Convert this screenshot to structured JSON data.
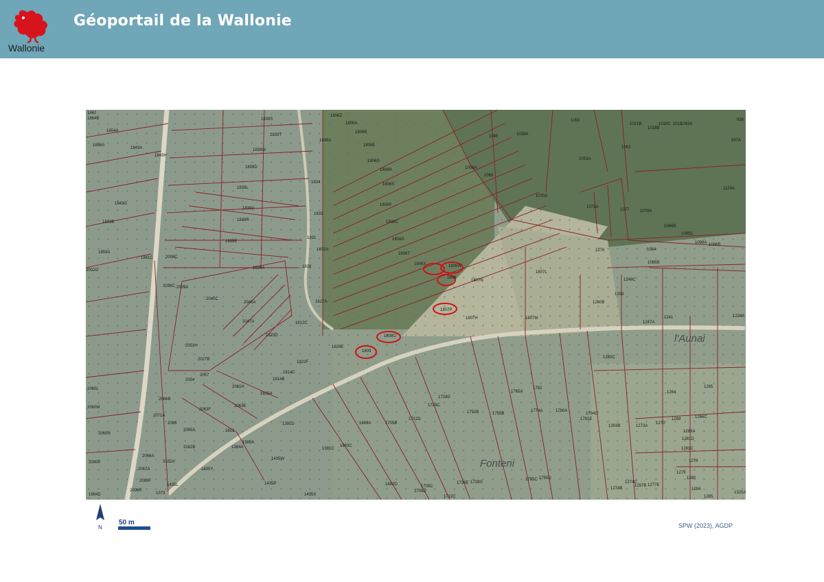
{
  "header": {
    "title": "Géoportail de la Wallonie",
    "logo_text": "Wallonie",
    "background_color": "#6fa6b8"
  },
  "map": {
    "place_labels": [
      "l'Aunai",
      "Fonteni"
    ],
    "highlighted_parcels": [
      "1809",
      "1808C",
      "1807P",
      "1806X",
      "1806",
      "1806W"
    ],
    "highlight_color": "#d0101a",
    "parcel_labels": [
      {
        "id": "p1",
        "text": "1862"
      },
      {
        "id": "p2",
        "text": "1864B"
      },
      {
        "id": "p3",
        "text": "1854A"
      },
      {
        "id": "p4",
        "text": "1856A"
      },
      {
        "id": "p5",
        "text": "1843A"
      },
      {
        "id": "p6",
        "text": "1843H"
      },
      {
        "id": "p7",
        "text": "1843G"
      },
      {
        "id": "p8",
        "text": "1843B"
      },
      {
        "id": "p9",
        "text": "1859A"
      },
      {
        "id": "p10",
        "text": "1841C"
      },
      {
        "id": "p11",
        "text": "2008C"
      },
      {
        "id": "p12",
        "text": "2038C"
      },
      {
        "id": "p13",
        "text": "2039A"
      },
      {
        "id": "p14",
        "text": "2040C"
      },
      {
        "id": "p15",
        "text": "2046A"
      },
      {
        "id": "p16",
        "text": "2047A"
      },
      {
        "id": "p17",
        "text": "2051H"
      },
      {
        "id": "p18",
        "text": "2027B"
      },
      {
        "id": "p19",
        "text": "2054"
      },
      {
        "id": "p20",
        "text": "2057"
      },
      {
        "id": "p21",
        "text": "2060L"
      },
      {
        "id": "p22",
        "text": "2060M"
      },
      {
        "id": "p23",
        "text": "2060N"
      },
      {
        "id": "p24",
        "text": "2080P"
      },
      {
        "id": "p25",
        "text": "2066A"
      },
      {
        "id": "p26",
        "text": "2067A"
      },
      {
        "id": "p27",
        "text": "2069F"
      },
      {
        "id": "p28",
        "text": "1994D"
      },
      {
        "id": "p29",
        "text": "1839S"
      },
      {
        "id": "p30",
        "text": "1839T"
      },
      {
        "id": "p31",
        "text": "1839W"
      },
      {
        "id": "p32",
        "text": "1839D"
      },
      {
        "id": "p33",
        "text": "1839L"
      },
      {
        "id": "p34",
        "text": "1839V"
      },
      {
        "id": "p35",
        "text": "1839R"
      },
      {
        "id": "p36",
        "text": "1838E"
      },
      {
        "id": "p37",
        "text": "1839A"
      },
      {
        "id": "p38",
        "text": "1836A"
      },
      {
        "id": "p39",
        "text": "1834"
      },
      {
        "id": "p40",
        "text": "1833"
      },
      {
        "id": "p41",
        "text": "1831"
      },
      {
        "id": "p42",
        "text": "1832A"
      },
      {
        "id": "p43",
        "text": "1828"
      },
      {
        "id": "p44",
        "text": "1827A"
      },
      {
        "id": "p45",
        "text": "1812C"
      },
      {
        "id": "p46",
        "text": "1823D"
      },
      {
        "id": "p47",
        "text": "1822F"
      },
      {
        "id": "p48",
        "text": "1824E"
      },
      {
        "id": "p49",
        "text": "1814C"
      },
      {
        "id": "p50",
        "text": "1814B"
      },
      {
        "id": "p51",
        "text": "2061H"
      },
      {
        "id": "p52",
        "text": "1815A"
      },
      {
        "id": "p53",
        "text": "2063F"
      },
      {
        "id": "p54",
        "text": "2063E"
      },
      {
        "id": "p55",
        "text": "2065A"
      },
      {
        "id": "p56",
        "text": "3162B"
      },
      {
        "id": "p57",
        "text": "3182A"
      },
      {
        "id": "p58",
        "text": "1821"
      },
      {
        "id": "p59",
        "text": "1385A"
      },
      {
        "id": "p60",
        "text": "1384A"
      },
      {
        "id": "p61",
        "text": "1391D"
      },
      {
        "id": "p62",
        "text": "1435W"
      },
      {
        "id": "p63",
        "text": "1435Y"
      },
      {
        "id": "p64",
        "text": "1435P"
      },
      {
        "id": "p65",
        "text": "1435X"
      },
      {
        "id": "p66",
        "text": "1391C"
      },
      {
        "id": "p67",
        "text": "1683C"
      },
      {
        "id": "p68",
        "text": "1689A"
      },
      {
        "id": "p69",
        "text": "1705B"
      },
      {
        "id": "p70",
        "text": "1712D"
      },
      {
        "id": "p71",
        "text": "1724C"
      },
      {
        "id": "p72",
        "text": "1728D"
      },
      {
        "id": "p73",
        "text": "1752B"
      },
      {
        "id": "p74",
        "text": "1755B"
      },
      {
        "id": "p75",
        "text": "1765A"
      },
      {
        "id": "p76",
        "text": "1782"
      },
      {
        "id": "p77",
        "text": "1774A"
      },
      {
        "id": "p78",
        "text": "1790A"
      },
      {
        "id": "p79",
        "text": "1692D"
      },
      {
        "id": "p80",
        "text": "1705C"
      },
      {
        "id": "p81",
        "text": "1705D"
      },
      {
        "id": "p82",
        "text": "1712C"
      },
      {
        "id": "p83",
        "text": "1728E"
      },
      {
        "id": "p84",
        "text": "1728G"
      },
      {
        "id": "p85",
        "text": "1755C"
      },
      {
        "id": "p86",
        "text": "1755D"
      },
      {
        "id": "p87",
        "text": "1806Z"
      },
      {
        "id": "p88",
        "text": "1806A"
      },
      {
        "id": "p89",
        "text": "1806B"
      },
      {
        "id": "p90",
        "text": "1806E"
      },
      {
        "id": "p91",
        "text": "1806G"
      },
      {
        "id": "p92",
        "text": "1806R"
      },
      {
        "id": "p93",
        "text": "1806S"
      },
      {
        "id": "p94",
        "text": "1806P"
      },
      {
        "id": "p95",
        "text": "1806C"
      },
      {
        "id": "p96",
        "text": "1806D"
      },
      {
        "id": "p97",
        "text": "1806T"
      },
      {
        "id": "p98",
        "text": "1806X"
      },
      {
        "id": "p99",
        "text": "1806W"
      },
      {
        "id": "p100",
        "text": "1806"
      },
      {
        "id": "p101",
        "text": "1807N"
      },
      {
        "id": "p102",
        "text": "1807P"
      },
      {
        "id": "p103",
        "text": "1807H"
      },
      {
        "id": "p104",
        "text": "1807M"
      },
      {
        "id": "p105",
        "text": "1807L"
      },
      {
        "id": "p106",
        "text": "1808C"
      },
      {
        "id": "p107",
        "text": "1809"
      },
      {
        "id": "p108",
        "text": "1045"
      },
      {
        "id": "p109",
        "text": "1039A"
      },
      {
        "id": "p110",
        "text": "1050"
      },
      {
        "id": "p111",
        "text": "1053A"
      },
      {
        "id": "p112",
        "text": "1058A"
      },
      {
        "id": "p113",
        "text": "1069"
      },
      {
        "id": "p114",
        "text": "1070A"
      },
      {
        "id": "p115",
        "text": "1073A"
      },
      {
        "id": "p116",
        "text": "1077"
      },
      {
        "id": "p117",
        "text": "1079A"
      },
      {
        "id": "p118",
        "text": "1066B"
      },
      {
        "id": "p119",
        "text": "1062"
      },
      {
        "id": "p120",
        "text": "1021B"
      },
      {
        "id": "p121",
        "text": "1018B"
      },
      {
        "id": "p122",
        "text": "1010C"
      },
      {
        "id": "p123",
        "text": "1011"
      },
      {
        "id": "p124",
        "text": "1043A"
      },
      {
        "id": "p125",
        "text": "936"
      },
      {
        "id": "p126",
        "text": "937A"
      },
      {
        "id": "p127",
        "text": "1129A"
      },
      {
        "id": "p128",
        "text": "1085C"
      },
      {
        "id": "p129",
        "text": "1098A"
      },
      {
        "id": "p130",
        "text": "1086B"
      },
      {
        "id": "p131",
        "text": "1276"
      },
      {
        "id": "p132",
        "text": "1084"
      },
      {
        "id": "p133",
        "text": "1085B"
      },
      {
        "id": "p134",
        "text": "1248C"
      },
      {
        "id": "p135",
        "text": "1253"
      },
      {
        "id": "p136",
        "text": "1260B"
      },
      {
        "id": "p137",
        "text": "1247A"
      },
      {
        "id": "p138",
        "text": "1241"
      },
      {
        "id": "p139",
        "text": "1234A"
      },
      {
        "id": "p140",
        "text": "1260C"
      },
      {
        "id": "p141",
        "text": "1264"
      },
      {
        "id": "p142",
        "text": "1265"
      },
      {
        "id": "p143",
        "text": "1263B"
      },
      {
        "id": "p144",
        "text": "1273A"
      },
      {
        "id": "p145",
        "text": "1270"
      },
      {
        "id": "p146",
        "text": "1269"
      },
      {
        "id": "p147",
        "text": "1266C"
      },
      {
        "id": "p148",
        "text": "1283A"
      },
      {
        "id": "p149",
        "text": "1281D"
      },
      {
        "id": "p150",
        "text": "1281C"
      },
      {
        "id": "p151",
        "text": "1278"
      },
      {
        "id": "p152",
        "text": "1279"
      },
      {
        "id": "p153",
        "text": "1280"
      },
      {
        "id": "p154",
        "text": "1284"
      },
      {
        "id": "p155",
        "text": "1285"
      },
      {
        "id": "p156",
        "text": "1325A"
      },
      {
        "id": "p157",
        "text": "1274B"
      },
      {
        "id": "p158",
        "text": "1274C"
      },
      {
        "id": "p159",
        "text": "1297B"
      },
      {
        "id": "p160",
        "text": "1277E"
      },
      {
        "id": "p161",
        "text": "1373"
      },
      {
        "id": "p162",
        "text": "1435L"
      },
      {
        "id": "p163",
        "text": "2002G"
      },
      {
        "id": "p164",
        "text": "2066B"
      },
      {
        "id": "p165",
        "text": "2071A"
      },
      {
        "id": "p166",
        "text": "2068"
      },
      {
        "id": "p167",
        "text": "2006R"
      },
      {
        "id": "p168",
        "text": "1794C"
      },
      {
        "id": "p169",
        "text": "1791E"
      }
    ]
  },
  "legend": {
    "north_label": "N",
    "scale_label": "50 m"
  },
  "footer": {
    "attribution": "SPW (2023), AGDP"
  }
}
